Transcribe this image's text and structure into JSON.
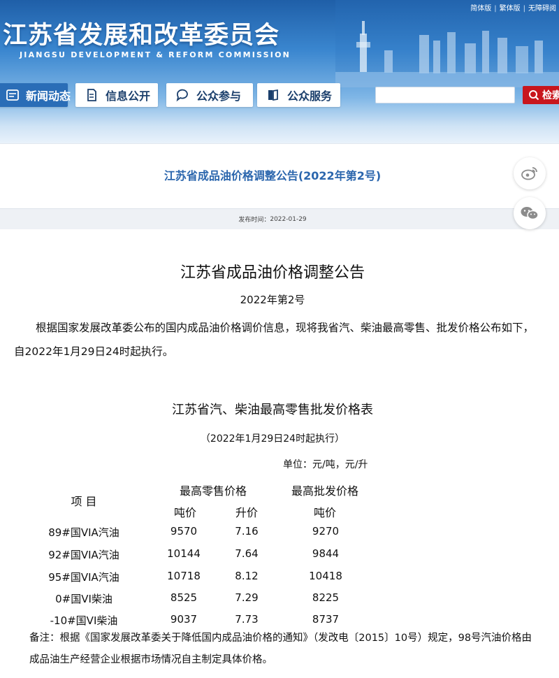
{
  "header": {
    "title": "江苏省发展和改革委员会",
    "subtitle": "JIANGSU DEVELOPMENT & REFORM COMMISSION",
    "top_links": [
      "简体版",
      "繁体版",
      "无障碍阅"
    ],
    "nav": [
      {
        "label": "新闻动态",
        "icon": "news-icon",
        "active": true
      },
      {
        "label": "信息公开",
        "icon": "document-icon",
        "active": false
      },
      {
        "label": "公众参与",
        "icon": "chat-icon",
        "active": false
      },
      {
        "label": "公众服务",
        "icon": "book-icon",
        "active": false
      }
    ],
    "search": {
      "placeholder": "",
      "button_label": "检索"
    }
  },
  "article": {
    "page_title": "江苏省成品油价格调整公告(2022年第2号)",
    "publish_label": "发布时间：",
    "publish_date": "2022-01-29",
    "share": [
      "weibo-icon",
      "wechat-icon"
    ]
  },
  "document": {
    "title": "江苏省成品油价格调整公告",
    "number": "2022年第2号",
    "body": "根据国家发展改革委公布的国内成品油价格调价信息，现将我省汽、柴油最高零售、批发价格公布如下，自2022年1月29日24时起执行。"
  },
  "table": {
    "title": "江苏省汽、柴油最高零售批发价格表",
    "subtitle": "（2022年1月29日24时起执行）",
    "unit": "单位：元/吨，元/升",
    "headers": {
      "item": "项 目",
      "retail": "最高零售价格",
      "wholesale": "最高批发价格",
      "ton_price": "吨价",
      "liter_price": "升价",
      "wholesale_ton": "吨价"
    },
    "rows": [
      {
        "item": "89#国VIA汽油",
        "ton": "9570",
        "liter": "7.16",
        "wholesale": "9270"
      },
      {
        "item": "92#国VIA汽油",
        "ton": "10144",
        "liter": "7.64",
        "wholesale": "9844"
      },
      {
        "item": "95#国VIA汽油",
        "ton": "10718",
        "liter": "8.12",
        "wholesale": "10418"
      },
      {
        "item": "0#国VI柴油",
        "ton": "8525",
        "liter": "7.29",
        "wholesale": "8225"
      },
      {
        "item": "-10#国VI柴油",
        "ton": "9037",
        "liter": "7.73",
        "wholesale": "8737"
      }
    ]
  },
  "note": "备注：根据《国家发展改革委关于降低国内成品油价格的通知》（发改电〔2015〕10号）规定，98号汽油价格由成品油生产经营企业根据市场情况自主制定具体价格。",
  "colors": {
    "accent": "#2a6db7",
    "title_blue": "#2b66ad",
    "search_red": "#c8161d"
  }
}
